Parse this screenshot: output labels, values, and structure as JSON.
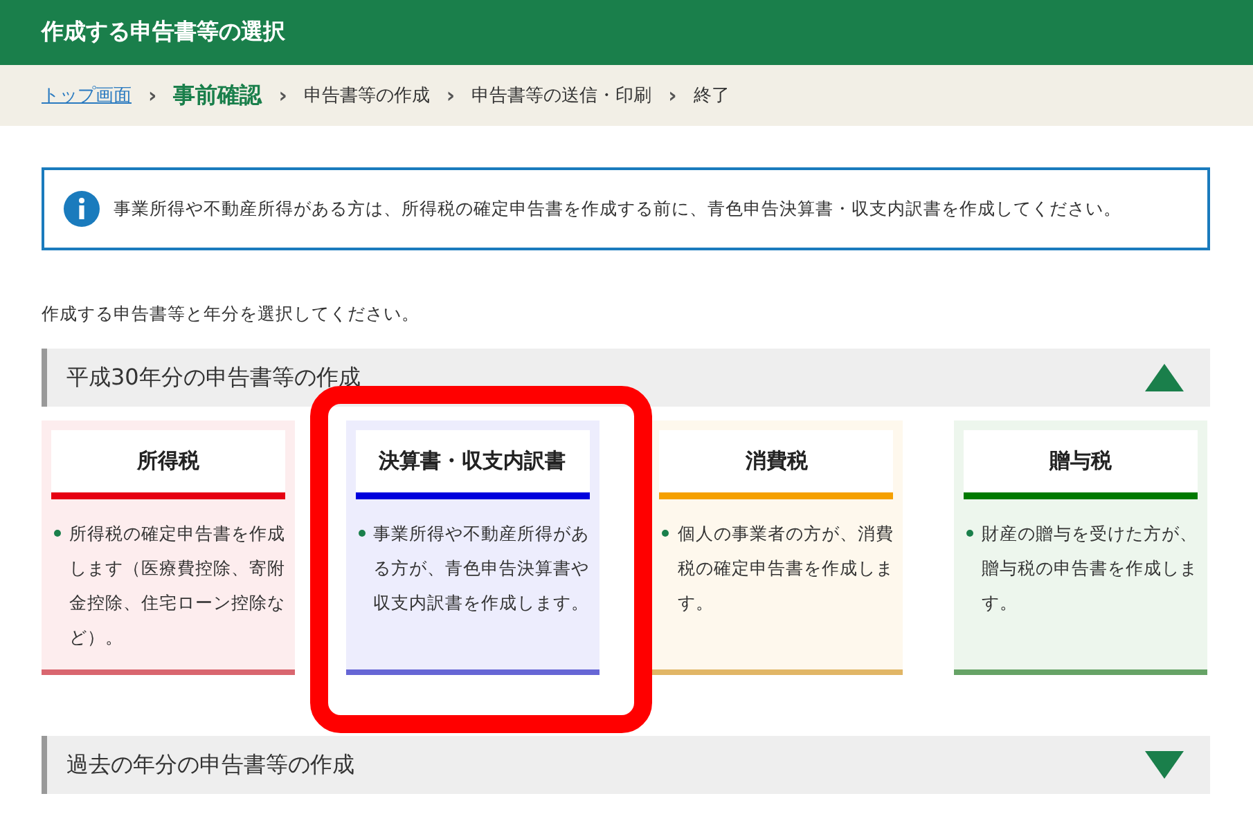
{
  "header": {
    "title": "作成する申告書等の選択"
  },
  "breadcrumb": [
    {
      "kind": "link",
      "label": "トップ画面",
      "selected": false
    },
    {
      "kind": "step",
      "label": "事前確認",
      "selected": true
    },
    {
      "kind": "step",
      "label": "申告書等の作成",
      "selected": false
    },
    {
      "kind": "step",
      "label": "申告書等の送信・印刷",
      "selected": false
    },
    {
      "kind": "step",
      "label": "終了",
      "selected": false
    }
  ],
  "separator": "›",
  "notice": {
    "text": "事業所得や不動産所得がある方は、所得税の確定申告書を作成する前に、青色申告決算書・収支内訳書を作成してください。"
  },
  "instruction": "作成する申告書等と年分を選択してください。",
  "sections": [
    {
      "title": "平成30年分の申告書等の作成",
      "expanded": true,
      "cards": [
        {
          "title": "所得税",
          "color": "#e60012",
          "highlighted": false,
          "text": "所得税の確定申告書を作成します（医療費控除、寄附金控除、住宅ローン控除など）。"
        },
        {
          "title": "決算書・収支内訳書",
          "color": "#0000dd",
          "highlighted": true,
          "text": "事業所得や不動産所得がある方が、青色申告決算書や収支内訳書を作成します。"
        },
        {
          "title": "消費税",
          "color": "#f5a000",
          "highlighted": false,
          "text": "個人の事業者の方が、消費税の確定申告書を作成します。"
        },
        {
          "title": "贈与税",
          "color": "#007a00",
          "highlighted": false,
          "text": "財産の贈与を受けた方が、贈与税の申告書を作成します。"
        }
      ]
    },
    {
      "title": "過去の年分の申告書等の作成",
      "expanded": false
    }
  ]
}
